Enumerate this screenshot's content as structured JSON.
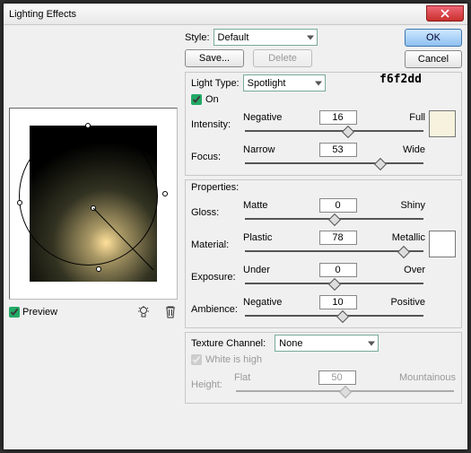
{
  "window": {
    "title": "Lighting Effects"
  },
  "buttons": {
    "ok": "OK",
    "cancel": "Cancel",
    "save": "Save...",
    "delete": "Delete"
  },
  "style": {
    "label": "Style:",
    "value": "Default"
  },
  "light_type": {
    "section_label": "Light Type:",
    "value": "Spotlight",
    "on_label": "On",
    "on_checked": true,
    "color_hex": "f6f2dd",
    "intensity": {
      "label": "Intensity:",
      "min": "Negative",
      "max": "Full",
      "value": "16",
      "pct": 58
    },
    "focus": {
      "label": "Focus:",
      "min": "Narrow",
      "max": "Wide",
      "value": "53",
      "pct": 76
    }
  },
  "properties": {
    "section_label": "Properties:",
    "gloss": {
      "label": "Gloss:",
      "min": "Matte",
      "max": "Shiny",
      "value": "0",
      "pct": 50
    },
    "material": {
      "label": "Material:",
      "min": "Plastic",
      "max": "Metallic",
      "value": "78",
      "pct": 89
    },
    "exposure": {
      "label": "Exposure:",
      "min": "Under",
      "max": "Over",
      "value": "0",
      "pct": 50
    },
    "ambience": {
      "label": "Ambience:",
      "min": "Negative",
      "max": "Positive",
      "value": "10",
      "pct": 55
    }
  },
  "texture": {
    "label": "Texture Channel:",
    "value": "None",
    "white_is_high_label": "White is high",
    "white_is_high_checked": true,
    "height": {
      "label": "Height:",
      "min": "Flat",
      "max": "Mountainous",
      "value": "50",
      "pct": 50
    }
  },
  "preview": {
    "label": "Preview",
    "checked": true
  }
}
